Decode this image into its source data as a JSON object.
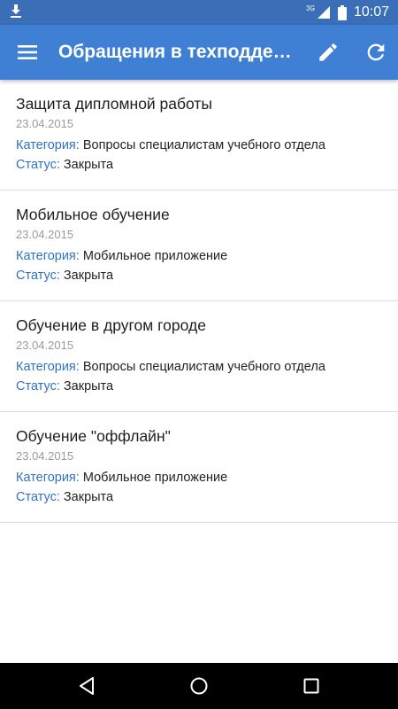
{
  "status_bar": {
    "time": "10:07",
    "network": "3G",
    "icons": [
      "download-icon",
      "signal-icon",
      "battery-icon"
    ]
  },
  "app_bar": {
    "title": "Обращения в техподдержку",
    "icons": [
      "menu-icon",
      "edit-icon",
      "refresh-icon"
    ]
  },
  "colors": {
    "status_bar": "#3a6fb8",
    "app_bar": "#3f7fd4",
    "accent": "#2e72c6"
  },
  "requests": [
    {
      "title": "Защита дипломной работы",
      "date": "23.04.2015",
      "category_label": "Категория:",
      "category": "Вопросы специалистам учебного отдела",
      "status_label": "Статус:",
      "status": "Закрыта"
    },
    {
      "title": "Мобильное обучение",
      "date": "23.04.2015",
      "category_label": "Категория:",
      "category": "Мобильное приложение",
      "status_label": "Статус:",
      "status": "Закрыта"
    },
    {
      "title": "Обучение в другом городе",
      "date": "23.04.2015",
      "category_label": "Категория:",
      "category": "Вопросы специалистам учебного отдела",
      "status_label": "Статус:",
      "status": "Закрыта"
    },
    {
      "title": "Обучение \"оффлайн\"",
      "date": "23.04.2015",
      "category_label": "Категория:",
      "category": "Мобильное приложение",
      "status_label": "Статус:",
      "status": "Закрыта"
    }
  ],
  "nav_bar": {
    "icons": [
      "back-icon",
      "home-icon",
      "recents-icon"
    ]
  }
}
